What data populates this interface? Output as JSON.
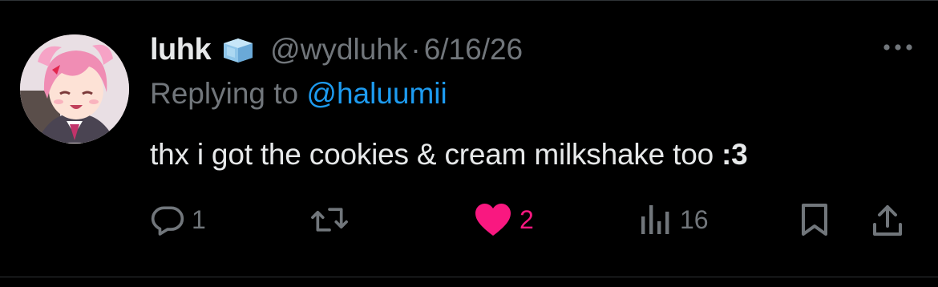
{
  "tweet": {
    "display_name": "luhk",
    "badge_icon": "ice-cube-emoji",
    "handle": "@wydluhk",
    "separator": "·",
    "date": "6/16/26",
    "reply_prefix": "Replying to",
    "reply_to": "@haluumii",
    "text_main": "thx i got the cookies & cream milkshake too ",
    "text_emphasis": ":3"
  },
  "actions": {
    "reply_count": "1",
    "retweet_count": "",
    "like_count": "2",
    "views_count": "16",
    "liked": true
  },
  "colors": {
    "background": "#000000",
    "text_primary": "#e7e9ea",
    "text_secondary": "#71767b",
    "link": "#1d9bf0",
    "like": "#f91880"
  }
}
